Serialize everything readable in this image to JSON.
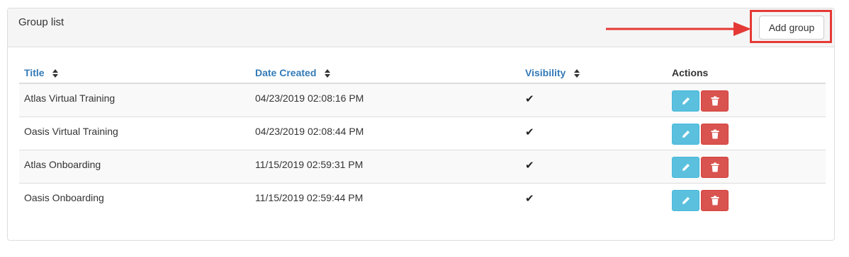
{
  "panel": {
    "title": "Group list",
    "add_button_label": "Add group"
  },
  "table": {
    "headers": {
      "title": "Title",
      "date_created": "Date Created",
      "visibility": "Visibility",
      "actions": "Actions"
    },
    "rows": [
      {
        "title": "Atlas Virtual Training",
        "date_created": "04/23/2019 02:08:16 PM",
        "visible": "✔"
      },
      {
        "title": "Oasis Virtual Training",
        "date_created": "04/23/2019 02:08:44 PM",
        "visible": "✔"
      },
      {
        "title": "Atlas Onboarding",
        "date_created": "11/15/2019 02:59:31 PM",
        "visible": "✔"
      },
      {
        "title": "Oasis Onboarding",
        "date_created": "11/15/2019 02:59:44 PM",
        "visible": "✔"
      }
    ]
  },
  "icons": {
    "sort": "sort-icon",
    "check": "check-icon",
    "edit": "pencil-icon",
    "delete": "trash-icon"
  },
  "colors": {
    "link": "#337ab7",
    "edit_button": "#5bc0de",
    "delete_button": "#d9534f",
    "annotation": "#e53935"
  }
}
